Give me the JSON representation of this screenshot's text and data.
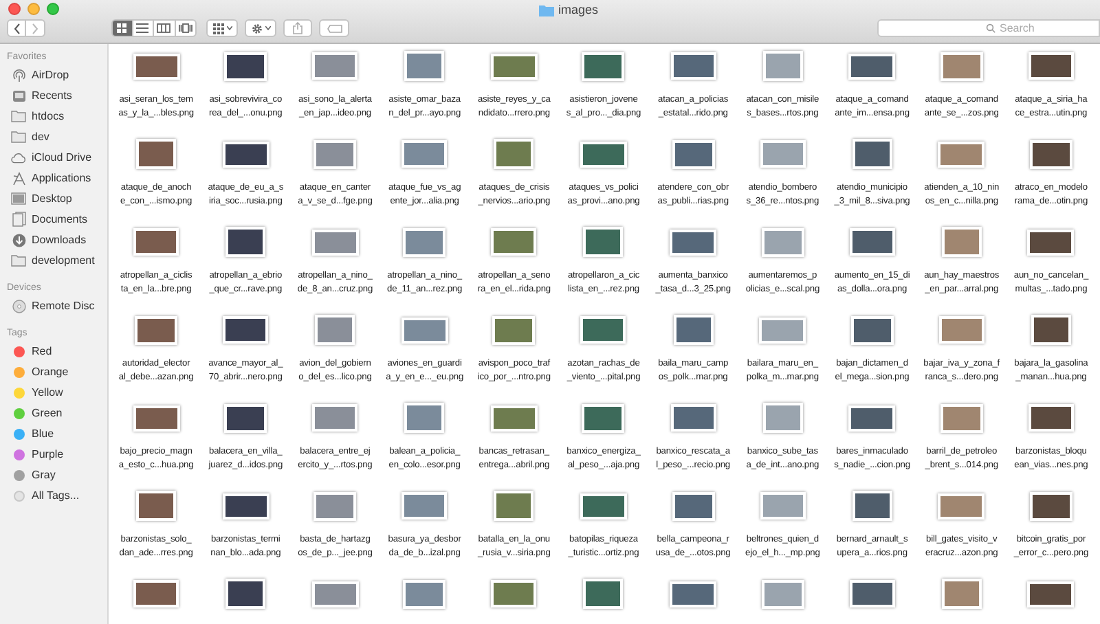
{
  "window": {
    "title": "images"
  },
  "toolbar": {
    "view_modes": [
      {
        "kind": "icons",
        "selected": true
      },
      {
        "kind": "list",
        "selected": false
      },
      {
        "kind": "columns",
        "selected": false
      },
      {
        "kind": "coverflow",
        "selected": false
      }
    ],
    "search": {
      "placeholder": "Search"
    }
  },
  "sidebar": {
    "sections": [
      {
        "title": "Favorites",
        "items": [
          {
            "label": "AirDrop",
            "kind": "airdrop"
          },
          {
            "label": "Recents",
            "kind": "recents"
          },
          {
            "label": "htdocs",
            "kind": "folder"
          },
          {
            "label": "dev",
            "kind": "folder"
          },
          {
            "label": "iCloud Drive",
            "kind": "cloud"
          },
          {
            "label": "Applications",
            "kind": "apps"
          },
          {
            "label": "Desktop",
            "kind": "desktop"
          },
          {
            "label": "Documents",
            "kind": "documents"
          },
          {
            "label": "Downloads",
            "kind": "downloads"
          },
          {
            "label": "development",
            "kind": "folder"
          }
        ]
      },
      {
        "title": "Devices",
        "items": [
          {
            "label": "Remote Disc",
            "kind": "disc"
          }
        ]
      },
      {
        "title": "Tags",
        "items": [
          {
            "label": "Red",
            "kind": "tag",
            "color": "#fc5753"
          },
          {
            "label": "Orange",
            "kind": "tag",
            "color": "#fdad3b"
          },
          {
            "label": "Yellow",
            "kind": "tag",
            "color": "#fdd73a"
          },
          {
            "label": "Green",
            "kind": "tag",
            "color": "#5fcf3f"
          },
          {
            "label": "Blue",
            "kind": "tag",
            "color": "#3ab0f6"
          },
          {
            "label": "Purple",
            "kind": "tag",
            "color": "#cf73e0"
          },
          {
            "label": "Gray",
            "kind": "tag",
            "color": "#a0a0a0"
          },
          {
            "label": "All Tags...",
            "kind": "all_tags"
          }
        ]
      }
    ]
  },
  "files": [
    {
      "kind": "file",
      "lines": [
        "asi_seran_los_tem",
        "as_y_la_...bles.png"
      ]
    },
    {
      "kind": "file",
      "lines": [
        "asi_sobrevivira_co",
        "rea_del_...onu.png"
      ]
    },
    {
      "kind": "file",
      "lines": [
        "asi_sono_la_alerta",
        "_en_jap...ideo.png"
      ]
    },
    {
      "kind": "file",
      "lines": [
        "asiste_omar_baza",
        "n_del_pr...ayo.png"
      ]
    },
    {
      "kind": "file",
      "lines": [
        "asiste_reyes_y_ca",
        "ndidato...rrero.png"
      ]
    },
    {
      "kind": "file",
      "lines": [
        "asistieron_jovene",
        "s_al_pro..._dia.png"
      ]
    },
    {
      "kind": "file",
      "lines": [
        "atacan_a_policias",
        "_estatal...rido.png"
      ]
    },
    {
      "kind": "file",
      "lines": [
        "atacan_con_misile",
        "s_bases...rtos.png"
      ]
    },
    {
      "kind": "file",
      "lines": [
        "ataque_a_comand",
        "ante_im...ensa.png"
      ]
    },
    {
      "kind": "file",
      "lines": [
        "ataque_a_comand",
        "ante_se_...zos.png"
      ]
    },
    {
      "kind": "file",
      "lines": [
        "ataque_a_siria_ha",
        "ce_estra...utin.png"
      ]
    },
    {
      "kind": "file",
      "lines": [
        "ataque_de_anoch",
        "e_con_...ismo.png"
      ]
    },
    {
      "kind": "file",
      "lines": [
        "ataque_de_eu_a_s",
        "iria_soc...rusia.png"
      ]
    },
    {
      "kind": "file",
      "lines": [
        "ataque_en_canter",
        "a_v_se_d...fge.png"
      ]
    },
    {
      "kind": "file",
      "lines": [
        "ataque_fue_vs_ag",
        "ente_jor...alia.png"
      ]
    },
    {
      "kind": "file",
      "lines": [
        "ataques_de_crisis",
        "_nervios...ario.png"
      ]
    },
    {
      "kind": "file",
      "lines": [
        "ataques_vs_polici",
        "as_provi...ano.png"
      ]
    },
    {
      "kind": "file",
      "lines": [
        "atendere_con_obr",
        "as_publi...rias.png"
      ]
    },
    {
      "kind": "file",
      "lines": [
        "atendio_bombero",
        "s_36_re...ntos.png"
      ]
    },
    {
      "kind": "file",
      "lines": [
        "atendio_municipio",
        "_3_mil_8...siva.png"
      ]
    },
    {
      "kind": "file",
      "lines": [
        "atienden_a_10_nin",
        "os_en_c...nilla.png"
      ]
    },
    {
      "kind": "file",
      "lines": [
        "atraco_en_modelo",
        "rama_de...otin.png"
      ]
    },
    {
      "kind": "file",
      "lines": [
        "atropellan_a_ciclis",
        "ta_en_la...bre.png"
      ]
    },
    {
      "kind": "file",
      "lines": [
        "atropellan_a_ebrio",
        "_que_cr...rave.png"
      ]
    },
    {
      "kind": "file",
      "lines": [
        "atropellan_a_nino_",
        "de_8_an...cruz.png"
      ]
    },
    {
      "kind": "file",
      "lines": [
        "atropellan_a_nino_",
        "de_11_an...rez.png"
      ]
    },
    {
      "kind": "file",
      "lines": [
        "atropellan_a_seno",
        "ra_en_el...rida.png"
      ]
    },
    {
      "kind": "file",
      "lines": [
        "atropellaron_a_cic",
        "lista_en_...rez.png"
      ]
    },
    {
      "kind": "file",
      "lines": [
        "aumenta_banxico",
        "_tasa_d...3_25.png"
      ]
    },
    {
      "kind": "file",
      "lines": [
        "aumentaremos_p",
        "olicias_e...scal.png"
      ]
    },
    {
      "kind": "file",
      "lines": [
        "aumento_en_15_di",
        "as_dolla...ora.png"
      ]
    },
    {
      "kind": "file",
      "lines": [
        "aun_hay_maestros",
        "_en_par...arral.png"
      ]
    },
    {
      "kind": "file",
      "lines": [
        "aun_no_cancelan_",
        "multas_...tado.png"
      ]
    },
    {
      "kind": "file",
      "lines": [
        "autoridad_elector",
        "al_debe...azan.png"
      ]
    },
    {
      "kind": "file",
      "lines": [
        "avance_mayor_al_",
        "70_abrir...nero.png"
      ]
    },
    {
      "kind": "file",
      "lines": [
        "avion_del_gobiern",
        "o_del_es...lico.png"
      ]
    },
    {
      "kind": "file",
      "lines": [
        "aviones_en_guardi",
        "a_y_en_e..._eu.png"
      ]
    },
    {
      "kind": "file",
      "lines": [
        "avispon_poco_traf",
        "ico_por_...ntro.png"
      ]
    },
    {
      "kind": "file",
      "lines": [
        "azotan_rachas_de",
        "_viento_...pital.png"
      ]
    },
    {
      "kind": "file",
      "lines": [
        "baila_maru_camp",
        "os_polk...mar.png"
      ]
    },
    {
      "kind": "file",
      "lines": [
        "bailara_maru_en_",
        "polka_m...mar.png"
      ]
    },
    {
      "kind": "file",
      "lines": [
        "bajan_dictamen_d",
        "el_mega...sion.png"
      ]
    },
    {
      "kind": "file",
      "lines": [
        "bajar_iva_y_zona_f",
        "ranca_s...dero.png"
      ]
    },
    {
      "kind": "file",
      "lines": [
        "bajara_la_gasolina",
        "_manan...hua.png"
      ]
    },
    {
      "kind": "file",
      "lines": [
        "bajo_precio_magn",
        "a_esto_c...hua.png"
      ]
    },
    {
      "kind": "file",
      "lines": [
        "balacera_en_villa_",
        "juarez_d...idos.png"
      ]
    },
    {
      "kind": "file",
      "lines": [
        "balacera_entre_ej",
        "ercito_y_...rtos.png"
      ]
    },
    {
      "kind": "file",
      "lines": [
        "balean_a_policia_",
        "en_colo...esor.png"
      ]
    },
    {
      "kind": "file",
      "lines": [
        "bancas_retrasan_",
        "entrega...abril.png"
      ]
    },
    {
      "kind": "file",
      "lines": [
        "banxico_energiza_",
        "al_peso_...aja.png"
      ]
    },
    {
      "kind": "file",
      "lines": [
        "banxico_rescata_a",
        "l_peso_...recio.png"
      ]
    },
    {
      "kind": "file",
      "lines": [
        "banxico_sube_tas",
        "a_de_int...ano.png"
      ]
    },
    {
      "kind": "file",
      "lines": [
        "bares_inmaculado",
        "s_nadie_...cion.png"
      ]
    },
    {
      "kind": "file",
      "lines": [
        "barril_de_petroleo",
        "_brent_s...014.png"
      ]
    },
    {
      "kind": "file",
      "lines": [
        "barzonistas_bloqu",
        "ean_vias...nes.png"
      ]
    },
    {
      "kind": "file",
      "lines": [
        "barzonistas_solo_",
        "dan_ade...rres.png"
      ]
    },
    {
      "kind": "file",
      "lines": [
        "barzonistas_termi",
        "nan_blo...ada.png"
      ]
    },
    {
      "kind": "file",
      "lines": [
        "basta_de_hartazg",
        "os_de_p..._jee.png"
      ]
    },
    {
      "kind": "file",
      "lines": [
        "basura_ya_desbor",
        "da_de_b...izal.png"
      ]
    },
    {
      "kind": "file",
      "lines": [
        "batalla_en_la_onu",
        "_rusia_v...siria.png"
      ]
    },
    {
      "kind": "file",
      "lines": [
        "batopilas_riqueza",
        "_turistic...ortiz.png"
      ]
    },
    {
      "kind": "file",
      "lines": [
        "bella_campeona_r",
        "usa_de_...otos.png"
      ]
    },
    {
      "kind": "file",
      "lines": [
        "beltrones_quien_d",
        "ejo_el_h..._mp.png"
      ]
    },
    {
      "kind": "file",
      "lines": [
        "bernard_arnault_s",
        "upera_a...rios.png"
      ]
    },
    {
      "kind": "file",
      "lines": [
        "bill_gates_visito_v",
        "eracruz...azon.png"
      ]
    },
    {
      "kind": "file",
      "lines": [
        "bitcoin_gratis_por",
        "_error_c...pero.png"
      ]
    },
    {
      "kind": "cut_off"
    },
    {
      "kind": "cut_off"
    },
    {
      "kind": "cut_off"
    },
    {
      "kind": "cut_off"
    },
    {
      "kind": "cut_off"
    },
    {
      "kind": "cut_off"
    },
    {
      "kind": "cut_off"
    },
    {
      "kind": "cut_off"
    },
    {
      "kind": "cut_off"
    },
    {
      "kind": "cut_off"
    },
    {
      "kind": "cut_off"
    }
  ]
}
